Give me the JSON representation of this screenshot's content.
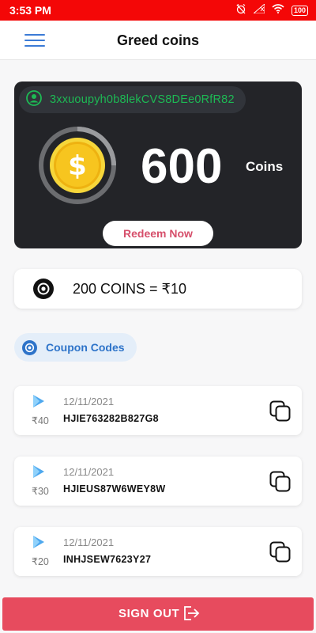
{
  "status_bar": {
    "time": "3:53 PM",
    "battery": "100",
    "icons": [
      "alarm-off-icon",
      "signal-icon",
      "wifi-icon",
      "battery-icon"
    ],
    "color": "#f40707"
  },
  "app_bar": {
    "title": "Greed coins",
    "menu_icon": "hamburger-menu-icon"
  },
  "wallet": {
    "address": "3xxuoupyh0b8lekCVS8DEe0RfR82",
    "balance": "600",
    "unit_label": "Coins",
    "redeem_label": "Redeem Now",
    "address_color": "#1db954"
  },
  "rate": {
    "text": "200 COINS = ₹10"
  },
  "coupons": {
    "section_label": "Coupon Codes",
    "items": [
      {
        "date": "12/11/2021",
        "code": "HJIE763282B827G8",
        "value": "₹40"
      },
      {
        "date": "12/11/2021",
        "code": "HJIEUS87W6WEY8W",
        "value": "₹30"
      },
      {
        "date": "12/11/2021",
        "code": "INHJSEW7623Y27",
        "value": "₹20"
      }
    ]
  },
  "signout": {
    "label": "SIGN OUT",
    "color": "#e74b5e"
  }
}
